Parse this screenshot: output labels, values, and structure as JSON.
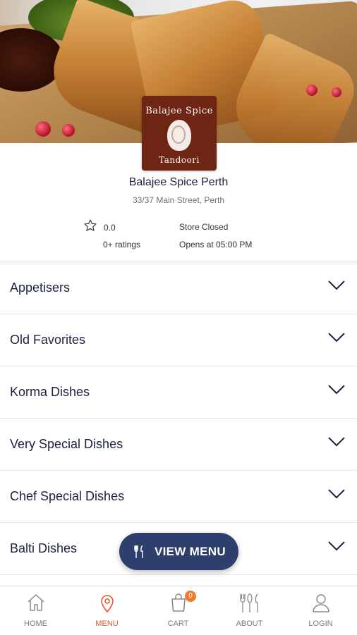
{
  "store": {
    "logo_text_top": "Balajee Spice",
    "logo_text_bottom": "Tandoori",
    "name": "Balajee Spice Perth",
    "address": "33/37 Main Street, Perth",
    "rating": "0.0",
    "ratings_count": "0+ ratings",
    "status": "Store Closed",
    "opens_at": "Opens at 05:00 PM"
  },
  "categories": [
    {
      "label": "Appetisers"
    },
    {
      "label": "Old Favorites"
    },
    {
      "label": "Korma Dishes"
    },
    {
      "label": "Very Special Dishes"
    },
    {
      "label": "Chef Special Dishes"
    },
    {
      "label": "Balti Dishes"
    }
  ],
  "view_menu_button": {
    "label": "VIEW MENU",
    "icon": "fork-knife-icon"
  },
  "bottom_nav": {
    "items": [
      {
        "label": "HOME",
        "icon": "home-icon"
      },
      {
        "label": "MENU",
        "icon": "location-pin-icon",
        "active": true
      },
      {
        "label": "CART",
        "icon": "shopping-bag-icon",
        "badge": "0"
      },
      {
        "label": "ABOUT",
        "icon": "cutlery-icon"
      },
      {
        "label": "LOGIN",
        "icon": "user-icon"
      }
    ]
  },
  "colors": {
    "accent": "#e4572e",
    "button_bg": "#2d3f6c",
    "logo_bg": "#6e2513",
    "badge": "#ef7b31",
    "text_dark": "#1d2140"
  }
}
